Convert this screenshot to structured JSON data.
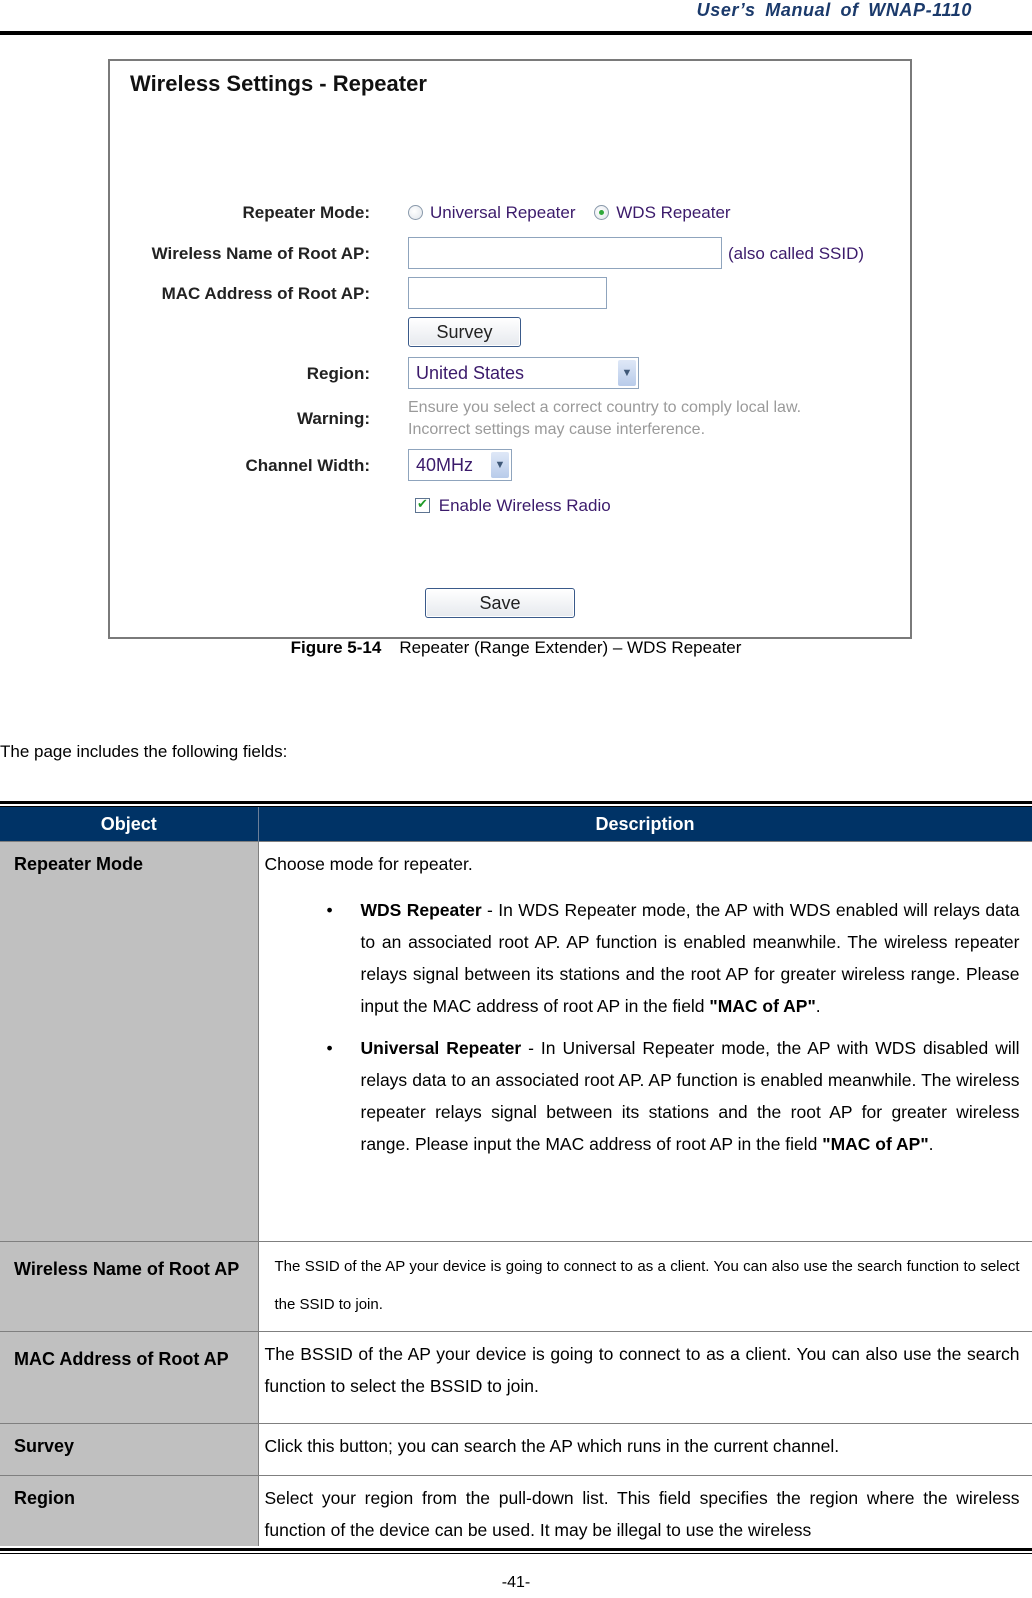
{
  "running_header": {
    "title": "User’s  Manual  of  WNAP-1110"
  },
  "figure": {
    "title": "Wireless Settings - Repeater",
    "fields": {
      "repeater_mode": {
        "label": "Repeater Mode:",
        "options": [
          {
            "label": "Universal Repeater",
            "checked": false
          },
          {
            "label": "WDS Repeater",
            "checked": true
          }
        ]
      },
      "wireless_name": {
        "label": "Wireless Name of Root AP:",
        "value": "",
        "hint": "(also called SSID)"
      },
      "mac_address": {
        "label": "MAC Address of Root AP:",
        "value": ""
      },
      "survey_button": "Survey",
      "region": {
        "label": "Region:",
        "selected": "United States"
      },
      "warning": {
        "label": "Warning:",
        "line1": "Ensure you select a correct country to comply local law.",
        "line2": "Incorrect settings may cause interference."
      },
      "channel_width": {
        "label": "Channel Width:",
        "selected": "40MHz"
      },
      "enable_radio": {
        "label": "Enable Wireless Radio",
        "checked": true
      },
      "save_button": "Save"
    }
  },
  "caption": {
    "number": "Figure 5-14",
    "text": "Repeater (Range Extender) – WDS Repeater"
  },
  "intro": "The page includes the following fields:",
  "table": {
    "headers": [
      "Object",
      "Description"
    ],
    "rows": [
      {
        "object": "Repeater Mode",
        "intro": "Choose mode for repeater.",
        "bullets": [
          {
            "term": "WDS Repeater",
            "text": " - In WDS Repeater mode, the AP with WDS enabled will relays data to an associated root AP. AP function is enabled meanwhile. The wireless repeater relays signal between its stations and the root AP for greater wireless range. Please input the MAC address of root AP in the field ",
            "field": "\"MAC of AP\"",
            "end": "."
          },
          {
            "term": "Universal Repeater",
            "text": " - In Universal Repeater mode, the AP with WDS disabled will relays data to an associated root AP. AP function is enabled meanwhile. The wireless repeater relays signal between its stations and the root AP for greater wireless range. Please input the MAC address of root AP in the field ",
            "field": "\"MAC of AP\"",
            "end": "."
          }
        ]
      },
      {
        "object": "Wireless Name of Root AP",
        "description": "The SSID of the AP your device is going to connect to as a client. You can also use the search function to select the SSID to join."
      },
      {
        "object": "MAC Address of Root AP",
        "description": "The BSSID of the AP your device is going to connect to as a client. You can also use the search function to select the BSSID to join."
      },
      {
        "object": "Survey",
        "description": "Click this button; you can search the AP which runs in the current channel."
      },
      {
        "object": "Region",
        "description": "Select your region from the pull-down list. This field specifies the region where the wireless function of the device can be used. It may be illegal to use the wireless"
      }
    ]
  },
  "page_number": "-41-",
  "colors": {
    "table_header_bg": "#003366",
    "object_cell_bg": "#c0c0c0",
    "header_title": "#1b3a6b"
  }
}
